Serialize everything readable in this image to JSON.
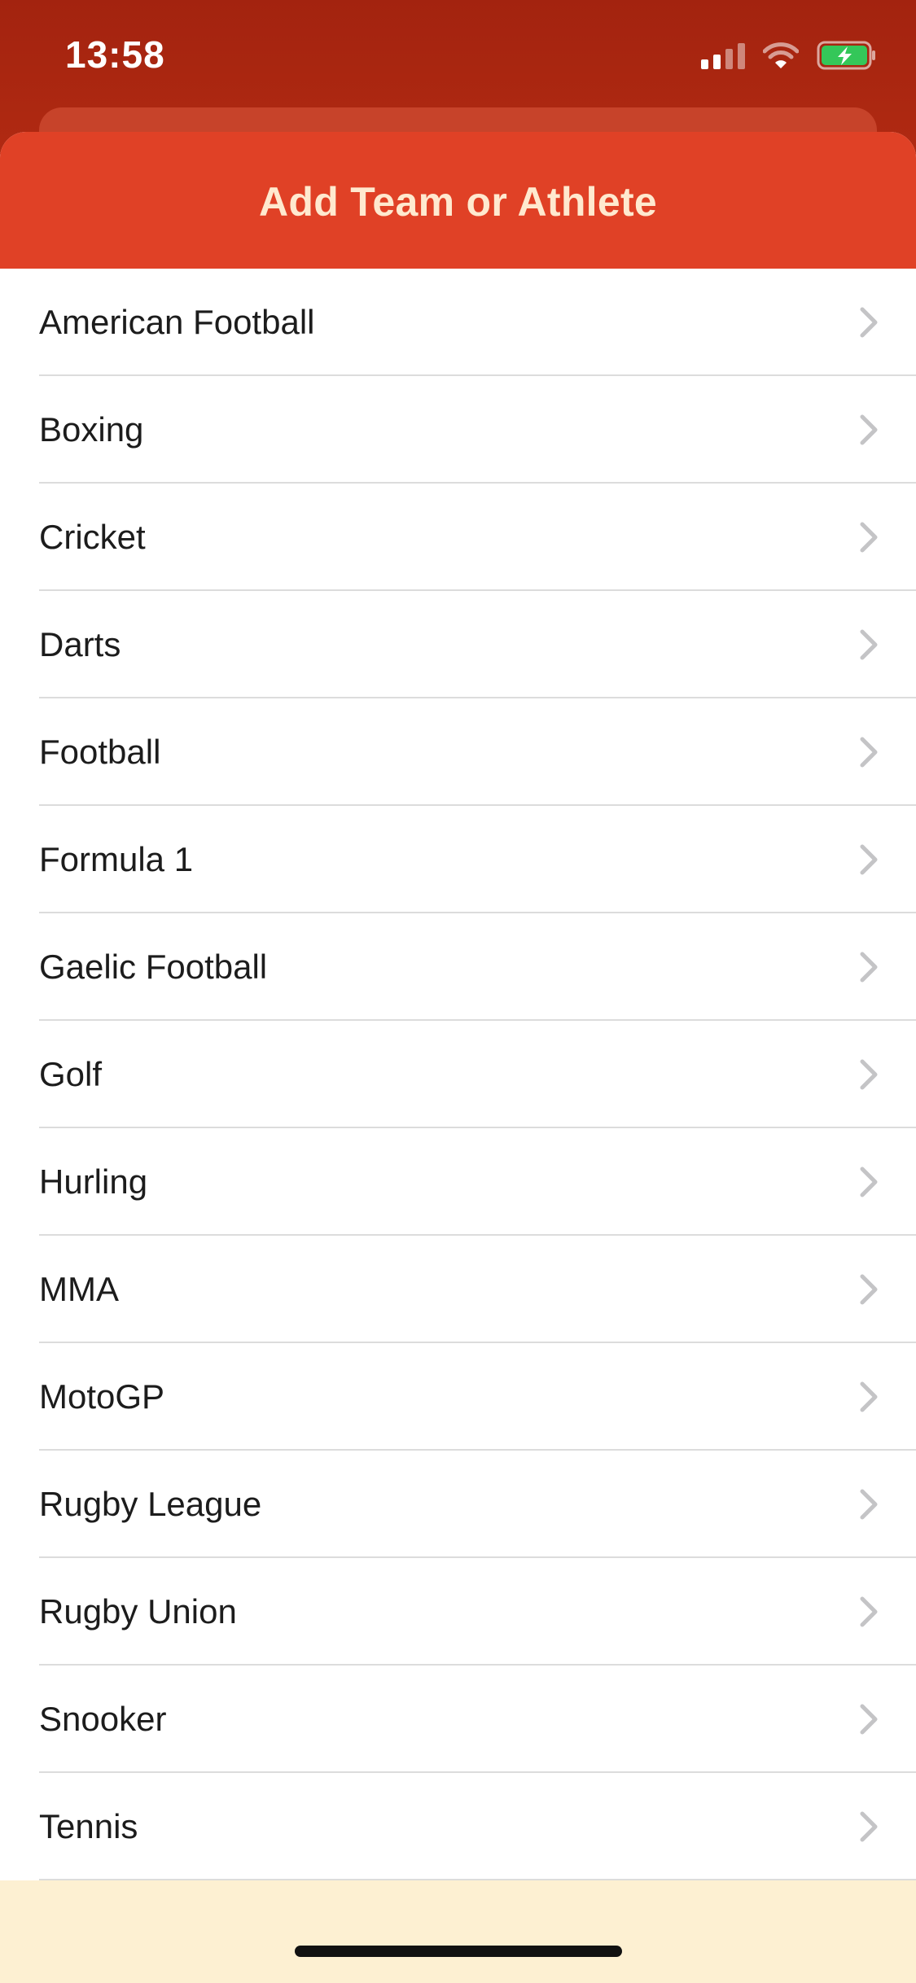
{
  "status_bar": {
    "time": "13:58",
    "signal_icon": "cellular-signal-icon",
    "wifi_icon": "wifi-icon",
    "battery_icon": "battery-charging-icon",
    "battery_color": "#34c759"
  },
  "sheet": {
    "title": "Add Team or Athlete",
    "header_color": "#e04126"
  },
  "sports": [
    {
      "label": "American Football"
    },
    {
      "label": "Boxing"
    },
    {
      "label": "Cricket"
    },
    {
      "label": "Darts"
    },
    {
      "label": "Football"
    },
    {
      "label": "Formula 1"
    },
    {
      "label": "Gaelic Football"
    },
    {
      "label": "Golf"
    },
    {
      "label": "Hurling"
    },
    {
      "label": "MMA"
    },
    {
      "label": "MotoGP"
    },
    {
      "label": "Rugby League"
    },
    {
      "label": "Rugby Union"
    },
    {
      "label": "Snooker"
    },
    {
      "label": "Tennis"
    }
  ],
  "row_icon": "chevron-right-icon"
}
